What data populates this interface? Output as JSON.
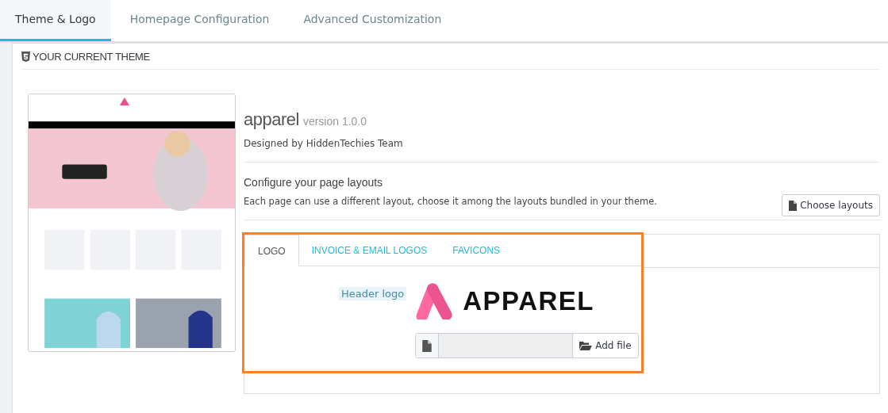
{
  "tabs": [
    {
      "label": "Theme & Logo",
      "selected": true
    },
    {
      "label": "Homepage Configuration",
      "selected": false
    },
    {
      "label": "Advanced Customization",
      "selected": false
    }
  ],
  "panel": {
    "title": "YOUR CURRENT THEME",
    "theme": {
      "name": "apparel",
      "version": "version 1.0.0",
      "author": "Designed by HiddenTechies Team"
    },
    "layouts": {
      "title": "Configure your page layouts",
      "description": "Each page can use a different layout, choose it among the layouts bundled in your theme.",
      "button": "Choose layouts"
    },
    "logo_section": {
      "highlighted": true,
      "tabs": [
        {
          "label": "LOGO",
          "selected": true
        },
        {
          "label": "INVOICE & EMAIL LOGOS",
          "selected": false
        },
        {
          "label": "FAVICONS",
          "selected": false
        }
      ],
      "field_label": "Header logo",
      "logo_wordmark": "APPAREL",
      "add_file_button": "Add file"
    }
  }
}
